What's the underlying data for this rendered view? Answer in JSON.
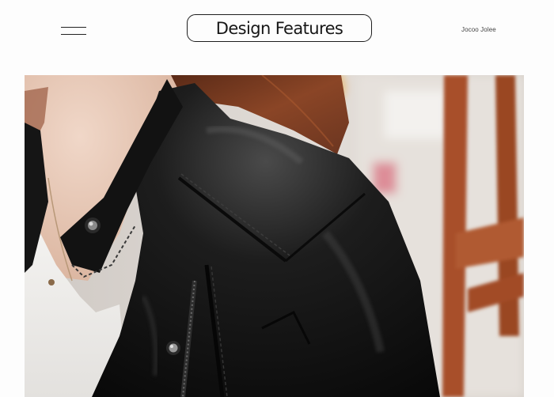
{
  "header": {
    "title": "Design Features",
    "brand": "Jocoo Jolee",
    "menu_icon": "hamburger-menu-icon"
  },
  "photo": {
    "subject": "black-leather-jacket-collar-detail",
    "colors": {
      "leather": "#141414",
      "hair": "#7a3a20",
      "skin": "#e6c7b5",
      "shirt": "#f1f0ee",
      "chair": "#a8502a"
    }
  }
}
